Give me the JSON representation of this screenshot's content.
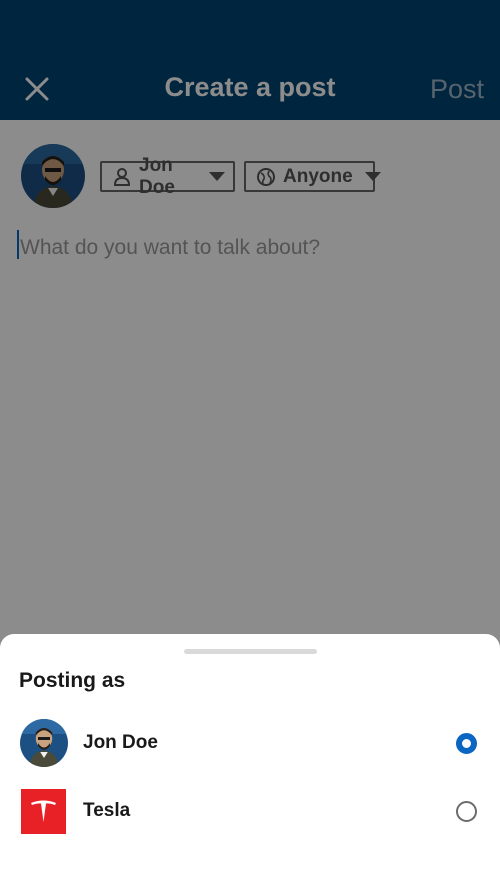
{
  "header": {
    "close_icon": "close-icon",
    "title": "Create a post",
    "post_label": "Post",
    "background": "#004471"
  },
  "composer": {
    "user_chip_label": "Jon Doe",
    "user_chip_icon": "person-icon",
    "visibility_chip_label": "Anyone",
    "visibility_chip_icon": "globe-icon",
    "placeholder": "What do you want to talk about?"
  },
  "sheet": {
    "title": "Posting as",
    "options": [
      {
        "label": "Jon Doe",
        "icon": "avatar",
        "selected": true
      },
      {
        "label": "Tesla",
        "icon": "tesla-logo-icon",
        "selected": false
      }
    ],
    "accent": "#0a66c2"
  }
}
